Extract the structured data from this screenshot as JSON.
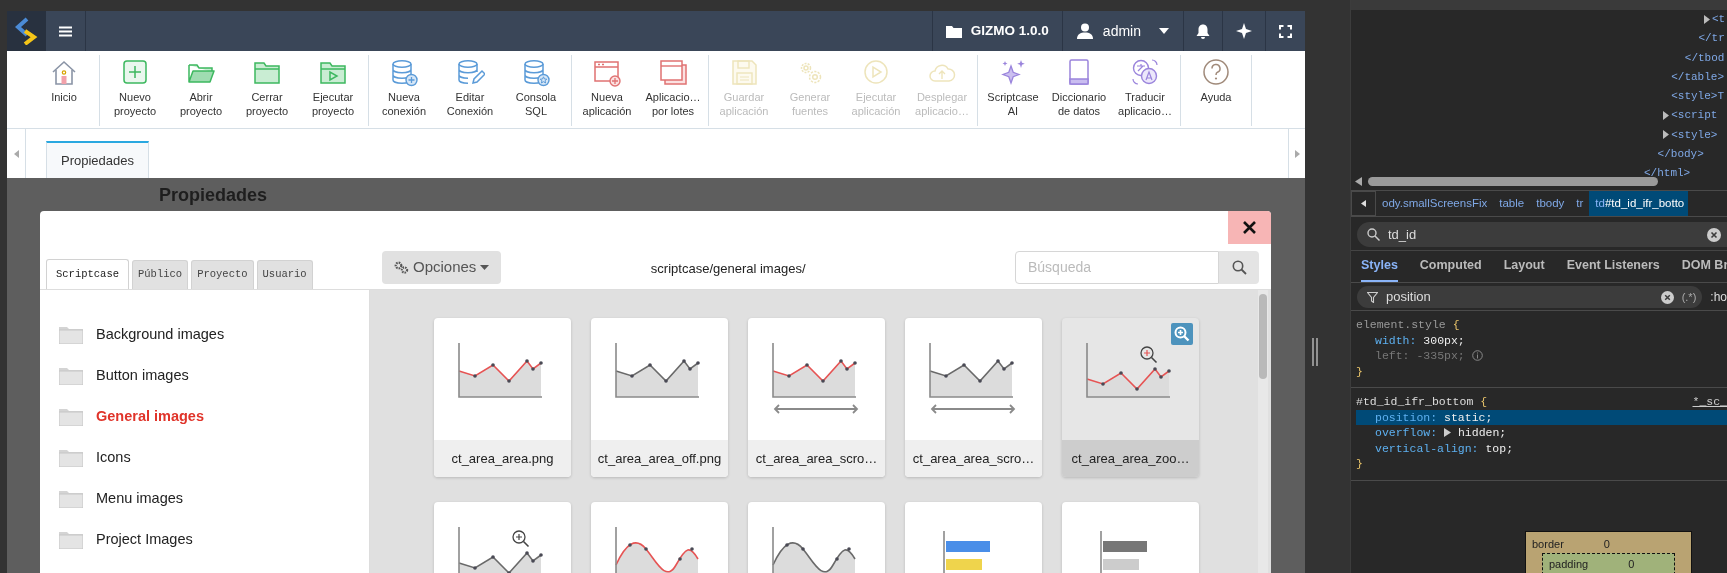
{
  "topbar": {
    "project": "GIZMO 1.0.0",
    "user": "admin"
  },
  "toolbar": {
    "groups": [
      {
        "items": [
          {
            "label": "Inicio",
            "disabled": false
          }
        ]
      },
      {
        "items": [
          {
            "label": "Nuevo\nproyecto",
            "disabled": false
          },
          {
            "label": "Abrir\nproyecto",
            "disabled": false
          },
          {
            "label": "Cerrar\nproyecto",
            "disabled": false
          },
          {
            "label": "Ejecutar\nproyecto",
            "disabled": false
          }
        ]
      },
      {
        "items": [
          {
            "label": "Nueva\nconexión",
            "disabled": false
          },
          {
            "label": "Editar\nConexión",
            "disabled": false
          },
          {
            "label": "Consola\nSQL",
            "disabled": false
          }
        ]
      },
      {
        "items": [
          {
            "label": "Nueva\naplicación",
            "disabled": false
          },
          {
            "label": "Aplicacio…\npor lotes",
            "disabled": false
          }
        ]
      },
      {
        "items": [
          {
            "label": "Guardar\naplicación",
            "disabled": true
          },
          {
            "label": "Generar\nfuentes",
            "disabled": true
          },
          {
            "label": "Ejecutar\naplicación",
            "disabled": true
          },
          {
            "label": "Desplegar\naplicacio…",
            "disabled": true
          }
        ]
      },
      {
        "items": [
          {
            "label": "Scriptcase\nAI",
            "disabled": false
          },
          {
            "label": "Diccionario\nde datos",
            "disabled": false
          },
          {
            "label": "Traducir\naplicacio…",
            "disabled": false
          }
        ]
      },
      {
        "items": [
          {
            "label": "Ayuda",
            "disabled": false
          }
        ]
      }
    ]
  },
  "page_tabs": [
    {
      "label": "Propiedades",
      "selected": true
    }
  ],
  "page_heading": "Propiedades",
  "dialog": {
    "tabs": [
      {
        "label": "Scriptcase",
        "selected": true
      },
      {
        "label": "Público",
        "selected": false
      },
      {
        "label": "Proyecto",
        "selected": false
      },
      {
        "label": "Usuario",
        "selected": false
      }
    ],
    "options_button": "Opciones",
    "path": "scriptcase/general images/",
    "search": {
      "placeholder": "Búsqueda"
    },
    "folders": [
      {
        "label": "Background images",
        "selected": false
      },
      {
        "label": "Button images",
        "selected": false
      },
      {
        "label": "General images",
        "selected": true
      },
      {
        "label": "Icons",
        "selected": false
      },
      {
        "label": "Menu images",
        "selected": false
      },
      {
        "label": "Project Images",
        "selected": false
      }
    ],
    "images": [
      {
        "name": "ct_area_area.png",
        "selected": false
      },
      {
        "name": "ct_area_area_off.png",
        "selected": false
      },
      {
        "name": "ct_area_area_scro…",
        "selected": false
      },
      {
        "name": "ct_area_area_scro…",
        "selected": false
      },
      {
        "name": "ct_area_area_zoo…",
        "selected": true
      },
      {
        "selected": false
      },
      {
        "selected": false
      },
      {
        "selected": false
      },
      {
        "selected": false
      },
      {
        "selected": false
      }
    ]
  },
  "devtools": {
    "tree": [
      {
        "close": "</html>",
        "children": [
          {
            "close": "</body>",
            "children": [
              {
                "close": "</table>",
                "children": [
                  {
                    "close": "</tbod",
                    "children": [
                      {
                        "close": "</tr",
                        "children": [
                          {
                            "open": "<t",
                            "expandable": true
                          }
                        ]
                      }
                    ]
                  }
                ]
              },
              {
                "open": "<style>T",
                "expandable": false
              },
              {
                "open": "<script",
                "expandable": true
              },
              {
                "open": "<style>",
                "expandable": true
              }
            ]
          }
        ]
      }
    ],
    "breadcrumb": [
      {
        "text": "ody.smallScreensFix",
        "selected": false
      },
      {
        "text": "table",
        "selected": false
      },
      {
        "text": "tbody",
        "selected": false
      },
      {
        "text": "tr",
        "selected": false
      },
      {
        "tag": "td",
        "text": "#td_id_ifr_botto",
        "selected": true
      }
    ],
    "search": "td_id",
    "tabs": [
      {
        "label": "Styles",
        "selected": true
      },
      {
        "label": "Computed",
        "selected": false
      },
      {
        "label": "Layout",
        "selected": false
      },
      {
        "label": "Event Listeners",
        "selected": false
      },
      {
        "label": "DOM Br",
        "selected": false
      }
    ],
    "filter": {
      "value": "position",
      "regex": "(.*)",
      "pseudo": ":ho"
    },
    "rules": [
      {
        "selector": "element.style",
        "open": "{",
        "close": "}",
        "props": [
          {
            "name": "width:",
            "value": "300px;",
            "inactive": false,
            "highlighted": false,
            "expandable": false
          },
          {
            "name": "left:",
            "value": "-335px;",
            "inactive": true,
            "highlighted": false,
            "expandable": false
          }
        ]
      },
      {
        "selector": "#td_id_ifr_bottom",
        "open": "{",
        "close": "}",
        "source": "*_sc_",
        "props": [
          {
            "name": "position:",
            "value": "static;",
            "inactive": false,
            "highlighted": true,
            "expandable": false
          },
          {
            "name": "overflow:",
            "value": "hidden;",
            "inactive": false,
            "highlighted": false,
            "expandable": true
          },
          {
            "name": "vertical-align:",
            "value": "top;",
            "inactive": false,
            "highlighted": false,
            "expandable": false
          }
        ]
      }
    ],
    "box_model": [
      {
        "label": "border",
        "value": "0"
      },
      {
        "label": "padding",
        "value": "0"
      }
    ]
  }
}
